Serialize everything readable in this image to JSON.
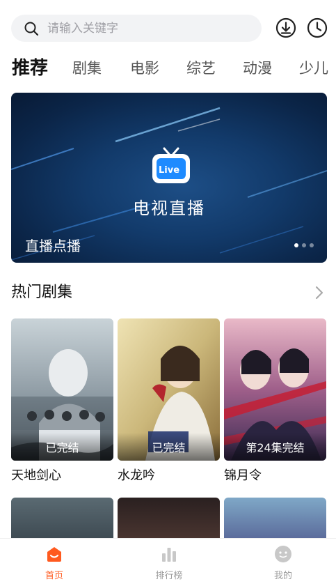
{
  "search": {
    "placeholder": "请输入关键字"
  },
  "header_icons": {
    "download": "download-icon",
    "history": "clock-icon"
  },
  "tabs": [
    {
      "label": "推荐",
      "active": true
    },
    {
      "label": "剧集"
    },
    {
      "label": "电影"
    },
    {
      "label": "综艺"
    },
    {
      "label": "动漫"
    },
    {
      "label": "少儿"
    }
  ],
  "banner": {
    "logo_text": "Live",
    "title": "电视直播",
    "caption": "直播点播",
    "dots": 3,
    "active_dot": 0
  },
  "section": {
    "title": "热门剧集",
    "more_icon": "chevron-right-icon"
  },
  "dramas": [
    {
      "title": "天地剑心",
      "badge": "已完结"
    },
    {
      "title": "水龙吟",
      "badge": "已完结"
    },
    {
      "title": "锦月令",
      "badge": "第24集完结"
    }
  ],
  "bottom_nav": [
    {
      "label": "首页",
      "icon": "home-icon",
      "active": true
    },
    {
      "label": "排行榜",
      "icon": "chart-icon"
    },
    {
      "label": "我的",
      "icon": "profile-icon"
    }
  ],
  "colors": {
    "accent": "#ff5a1f",
    "search_bg": "#f2f3f5"
  }
}
